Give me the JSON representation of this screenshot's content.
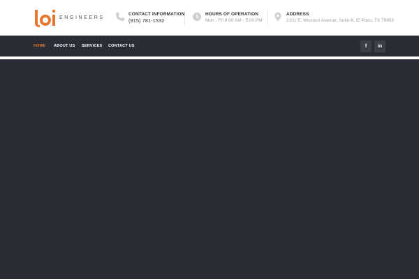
{
  "header": {
    "logo": {
      "mark": "loi",
      "wordmark": "ENGINEERS"
    },
    "contact": {
      "icon": "phone-icon",
      "title": "CONTACT INFORMATION",
      "value": "(915) 781-1532"
    },
    "hours": {
      "icon": "clock-icon",
      "title": "HOURS OF OPERATION",
      "value": "Mon - Fri 8:00 AM - 5:00 PM"
    },
    "address": {
      "icon": "map-pin-icon",
      "title": "ADDRESS",
      "value": "2101 E. Missouri Avenue, Suite B, El Paso, TX 79903"
    }
  },
  "nav": {
    "items": [
      {
        "label": "HOME",
        "active": true
      },
      {
        "label": "ABOUT US",
        "active": false
      },
      {
        "label": "SERVICES",
        "active": false
      },
      {
        "label": "CONTACT US",
        "active": false
      }
    ]
  },
  "social": [
    {
      "icon": "facebook-icon",
      "label": "f"
    },
    {
      "icon": "linkedin-icon",
      "label": "in"
    }
  ],
  "colors": {
    "accent": "#e8762c",
    "nav_bg": "#2a2d35",
    "header_bg": "#ffffff"
  }
}
